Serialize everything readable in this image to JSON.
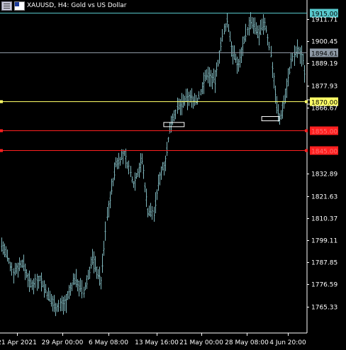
{
  "window": {
    "title": "XAUUSD, H4:  Gold vs US Dollar",
    "menu_icon": "chart-menu-icon",
    "flag_icon": "us-flag-icon"
  },
  "chart_data": {
    "type": "candlestick",
    "symbol": "XAUUSD",
    "timeframe": "H4",
    "description": "Gold vs US Dollar",
    "y_ticks": [
      "1911.71",
      "1900.45",
      "1889.19",
      "1877.93",
      "1866.67",
      "1832.89",
      "1821.63",
      "1810.37",
      "1799.11",
      "1787.85",
      "1776.59",
      "1765.33"
    ],
    "x_ticks": [
      "21 Apr 2021",
      "29 Apr 00:00",
      "6 May 08:00",
      "13 May 16:00",
      "21 May 00:00",
      "28 May 08:00",
      "4 Jun 20:00"
    ],
    "ylim": [
      1759.5,
      1920.0
    ],
    "bid": 1894.61,
    "bars_count": 208,
    "hlines": [
      {
        "label": "1915.00",
        "value": 1915.0,
        "color": "#58c8cc",
        "text_color": "#000000"
      },
      {
        "label": "1894.61",
        "value": 1894.61,
        "color": "#8f9aa6",
        "text_color": "#000000"
      },
      {
        "label": "1870.00",
        "value": 1870.0,
        "color": "#ffff66",
        "text_color": "#000000"
      },
      {
        "label": "1855.00",
        "value": 1855.0,
        "color": "#ff2020",
        "text_color": "#ff7070"
      },
      {
        "label": "1845.00",
        "value": 1845.0,
        "color": "#ff2020",
        "text_color": "#ff7070"
      }
    ],
    "keypoints": [
      [
        0,
        1797
      ],
      [
        8,
        1783
      ],
      [
        14,
        1788
      ],
      [
        20,
        1776
      ],
      [
        26,
        1780
      ],
      [
        32,
        1770
      ],
      [
        38,
        1765
      ],
      [
        44,
        1768
      ],
      [
        50,
        1780
      ],
      [
        56,
        1772
      ],
      [
        62,
        1790
      ],
      [
        68,
        1778
      ],
      [
        72,
        1812
      ],
      [
        78,
        1838
      ],
      [
        84,
        1843
      ],
      [
        90,
        1828
      ],
      [
        96,
        1840
      ],
      [
        100,
        1814
      ],
      [
        104,
        1813
      ],
      [
        108,
        1832
      ],
      [
        112,
        1840
      ],
      [
        116,
        1860
      ],
      [
        120,
        1866
      ],
      [
        128,
        1872
      ],
      [
        134,
        1870
      ],
      [
        140,
        1884
      ],
      [
        146,
        1880
      ],
      [
        150,
        1899
      ],
      [
        154,
        1911
      ],
      [
        158,
        1894
      ],
      [
        162,
        1888
      ],
      [
        166,
        1902
      ],
      [
        170,
        1910
      ],
      [
        176,
        1904
      ],
      [
        180,
        1910
      ],
      [
        184,
        1894
      ],
      [
        188,
        1868
      ],
      [
        190,
        1860
      ],
      [
        194,
        1873
      ],
      [
        198,
        1890
      ],
      [
        202,
        1896
      ],
      [
        206,
        1892
      ],
      [
        208,
        1878
      ],
      [
        212,
        1891
      ],
      [
        214,
        1895
      ]
    ],
    "markers": [
      {
        "bar": 118,
        "value": 1858,
        "width_bars": 14
      },
      {
        "bar": 184,
        "value": 1861,
        "width_bars": 12
      },
      {
        "bar": 212,
        "value": 1869.5,
        "width_bars": 6
      }
    ]
  }
}
